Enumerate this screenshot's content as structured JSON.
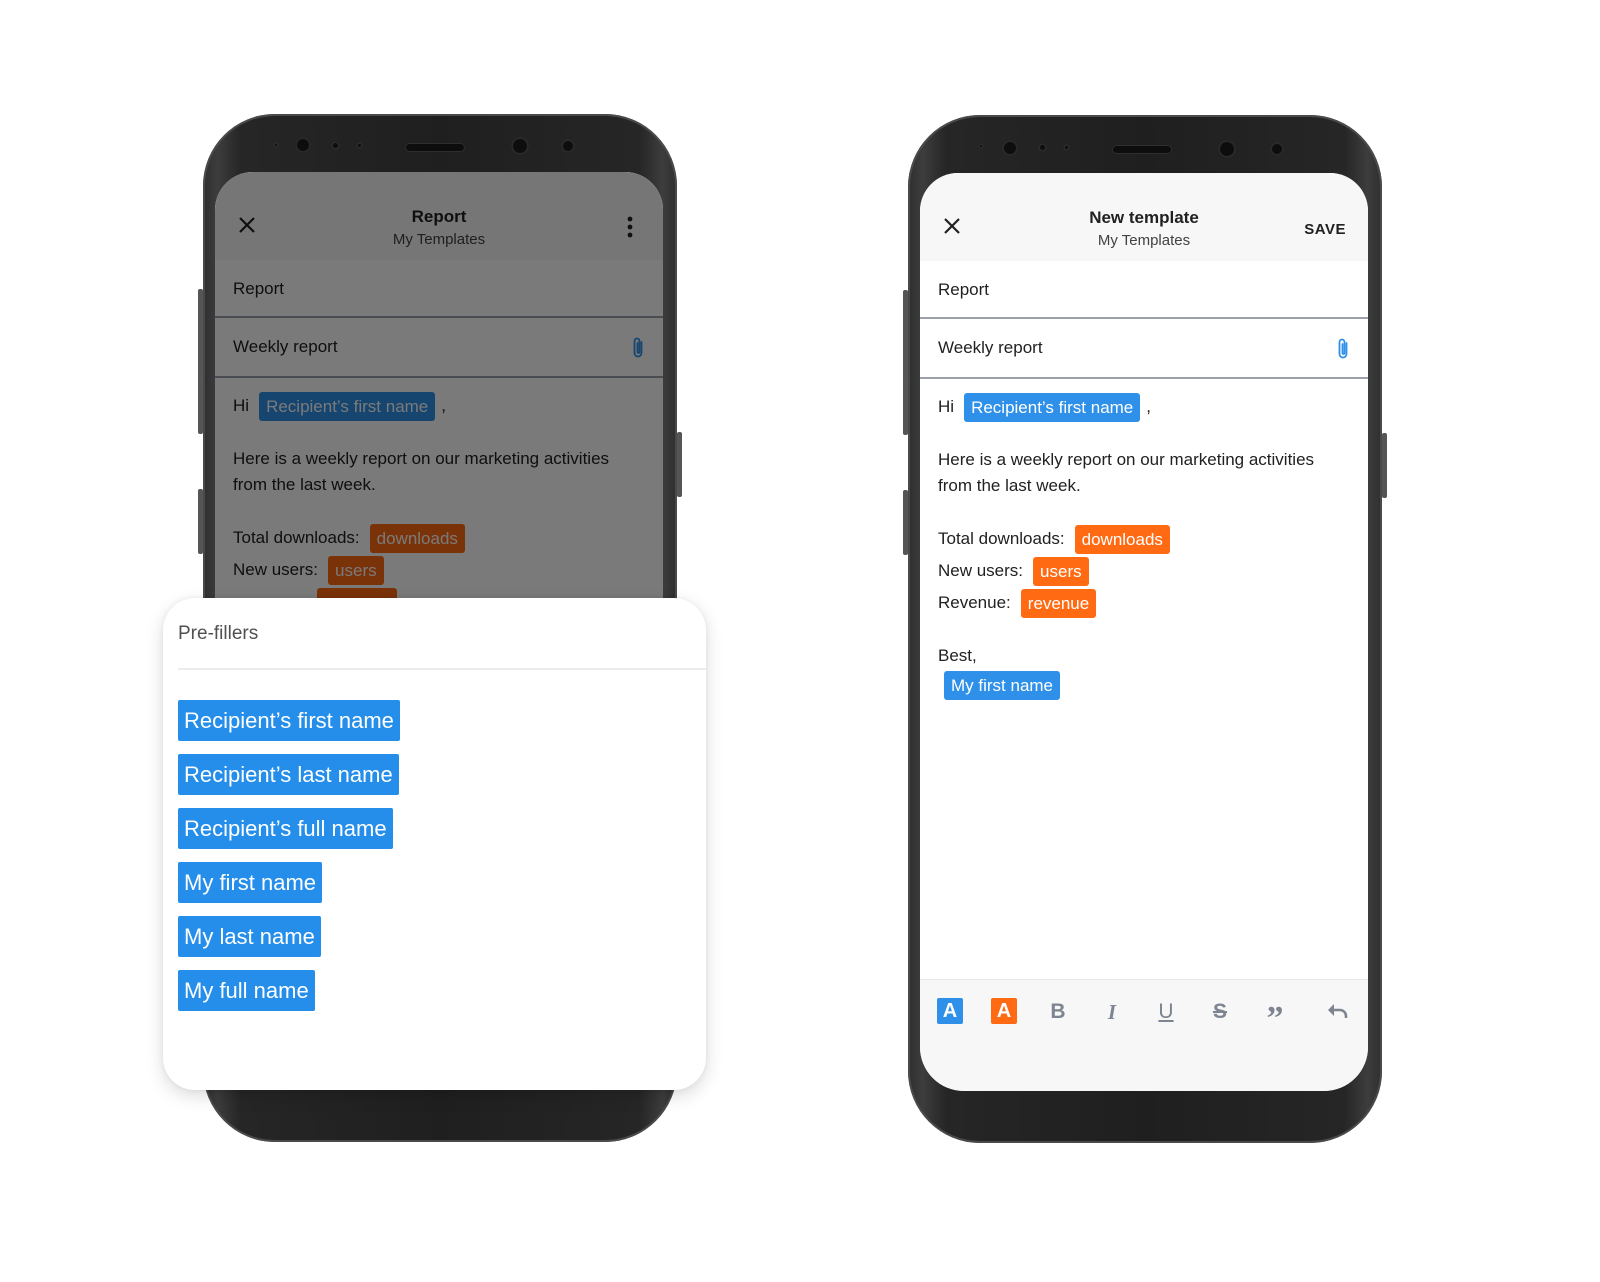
{
  "left_phone": {
    "appbar": {
      "title": "Report",
      "subtitle": "My Templates",
      "close_icon": "close-icon",
      "menu_icon": "more-vert-icon"
    },
    "name_field": {
      "value": "Report"
    },
    "subject_field": {
      "value": "Weekly report",
      "attach_icon": "paperclip-icon"
    },
    "body": {
      "greeting": "Hi",
      "greeting_chip": "Recipient’s first name",
      "comma": ",",
      "paragraph": "Here is a weekly report on our marketing activities from the last week.",
      "rows": [
        {
          "label": "Total downloads:",
          "chip": "downloads"
        },
        {
          "label": "New users:",
          "chip": "users"
        }
      ]
    }
  },
  "prefillers_sheet": {
    "heading": "Pre-fillers",
    "items": [
      "Recipient’s first name",
      "Recipient’s last name",
      "Recipient’s full name",
      "My first name",
      "My last name",
      "My full name"
    ]
  },
  "right_phone": {
    "appbar": {
      "title": "New template",
      "subtitle": "My Templates",
      "close_icon": "close-icon",
      "save_label": "SAVE"
    },
    "name_field": {
      "value": "Report"
    },
    "subject_field": {
      "value": "Weekly report",
      "attach_icon": "paperclip-icon"
    },
    "body": {
      "greeting": "Hi",
      "greeting_chip": "Recipient’s first name",
      "comma": ",",
      "paragraph": "Here is a weekly report on our marketing activities from the last week.",
      "rows": [
        {
          "label": "Total downloads:",
          "chip": "downloads"
        },
        {
          "label": "New users:",
          "chip": "users"
        },
        {
          "label": "Revenue:",
          "chip": "revenue"
        }
      ],
      "signoff": "Best,",
      "signature_chip": "My first name"
    },
    "toolbar": [
      {
        "icon": "text-color-blue-icon",
        "glyph": "A"
      },
      {
        "icon": "text-color-orange-icon",
        "glyph": "A"
      },
      {
        "icon": "bold-icon",
        "glyph": "B"
      },
      {
        "icon": "italic-icon",
        "glyph": "I"
      },
      {
        "icon": "underline-icon",
        "glyph": "U"
      },
      {
        "icon": "strikethrough-icon",
        "glyph": "S"
      },
      {
        "icon": "quote-icon",
        "glyph": "”"
      },
      {
        "icon": "undo-icon",
        "glyph": ""
      }
    ]
  },
  "colors": {
    "prefiller_blue": "#2e90e8",
    "metric_orange": "#ff6a12",
    "toolbar_icon_gray": "#7d8591",
    "attach_blue": "#2e90e8"
  }
}
